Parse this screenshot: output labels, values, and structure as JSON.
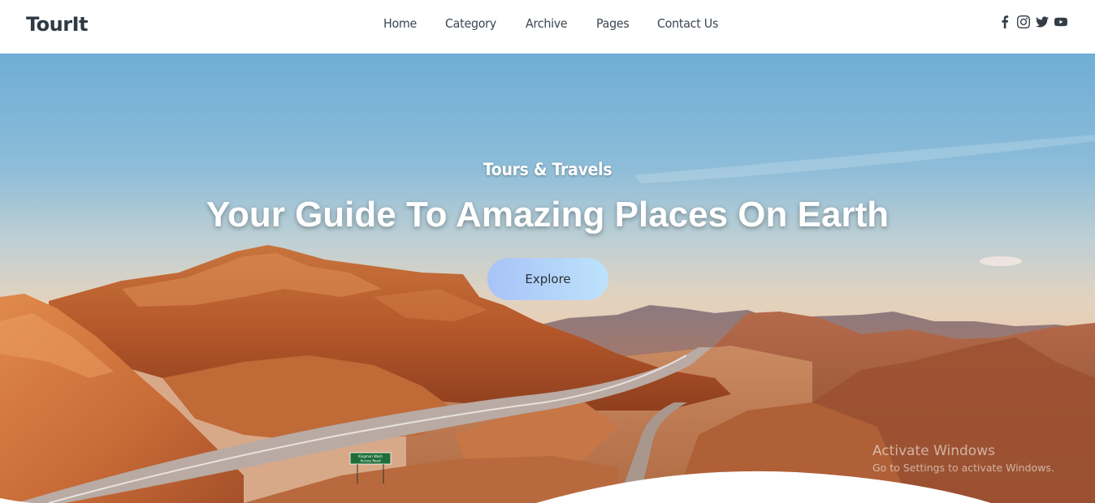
{
  "brand": {
    "name": "TourIt"
  },
  "nav": {
    "items": [
      {
        "label": "Home"
      },
      {
        "label": "Category"
      },
      {
        "label": "Archive"
      },
      {
        "label": "Pages"
      },
      {
        "label": "Contact Us"
      }
    ]
  },
  "social": {
    "icons": [
      "facebook-icon",
      "instagram-icon",
      "twitter-icon",
      "youtube-icon"
    ]
  },
  "hero": {
    "subtitle": "Tours & Travels",
    "title": "Your Guide To Amazing Places On Earth",
    "cta_label": "Explore"
  },
  "road_sign": {
    "line1": "Kingman Wash",
    "line2": "Access Road"
  },
  "watermark": {
    "line1": "Activate Windows",
    "line2": "Go to Settings to activate Windows."
  },
  "colors": {
    "brand_text": "#2f3a44",
    "nav_text": "#3c4650",
    "button_start": "#a8c2f8",
    "button_end": "#bde3fb"
  }
}
